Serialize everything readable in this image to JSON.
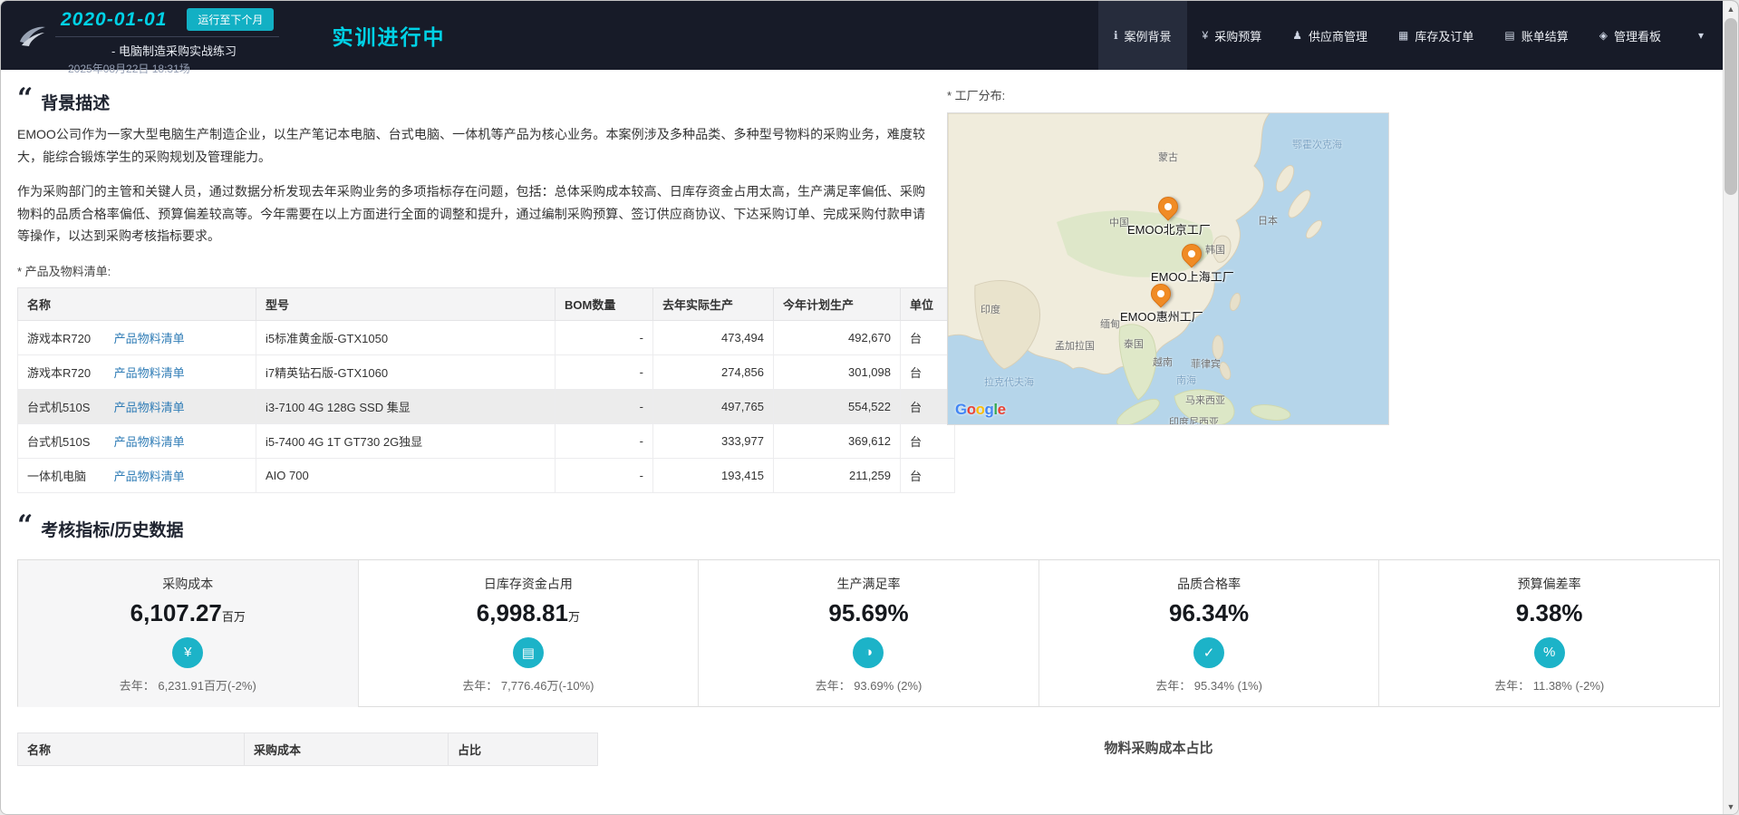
{
  "ui": {
    "quote_glyph": "“",
    "caret_glyph": "▾",
    "scroll_up_glyph": "▲",
    "scroll_down_glyph": "▼"
  },
  "navbar": {
    "date": "2020-01-01",
    "run_button": "运行至下个月",
    "subtitle": "- 电脑制造采购实战练习",
    "session": "2025年08月22日 18:31场",
    "status": "实训进行中",
    "items": [
      {
        "label": "案例背景",
        "icon": "info-icon",
        "glyph": "ℹ",
        "active": true
      },
      {
        "label": "采购预算",
        "icon": "budget-icon",
        "glyph": "¥",
        "active": false
      },
      {
        "label": "供应商管理",
        "icon": "supplier-icon",
        "glyph": "♟",
        "active": false
      },
      {
        "label": "库存及订单",
        "icon": "inventory-icon",
        "glyph": "▦",
        "active": false
      },
      {
        "label": "账单结算",
        "icon": "billing-icon",
        "glyph": "▤",
        "active": false
      },
      {
        "label": "管理看板",
        "icon": "dashboard-icon",
        "glyph": "◈",
        "active": false
      }
    ]
  },
  "background": {
    "title": "背景描述",
    "paragraphs": [
      "EMOO公司作为一家大型电脑生产制造企业，以生产笔记本电脑、台式电脑、一体机等产品为核心业务。本案例涉及多种品类、多种型号物料的采购业务，难度较大，能综合锻炼学生的采购规划及管理能力。",
      "作为采购部门的主管和关键人员，通过数据分析发现去年采购业务的多项指标存在问题，包括：总体采购成本较高、日库存资金占用太高，生产满足率偏低、采购物料的品质合格率偏低、预算偏差较高等。今年需要在以上方面进行全面的调整和提升，通过编制采购预算、签订供应商协议、下达采购订单、完成采购付款申请等操作，以达到采购考核指标要求。"
    ],
    "product_list_label": "* 产品及物料清单:",
    "table": {
      "headers": [
        "名称",
        "型号",
        "BOM数量",
        "去年实际生产",
        "今年计划生产",
        "单位"
      ],
      "link_label": "产品物料清单",
      "rows": [
        {
          "name": "游戏本R720",
          "model": "i5标准黄金版-GTX1050",
          "bom": "-",
          "last": "473,494",
          "plan": "492,670",
          "unit": "台"
        },
        {
          "name": "游戏本R720",
          "model": "i7精英钻石版-GTX1060",
          "bom": "-",
          "last": "274,856",
          "plan": "301,098",
          "unit": "台"
        },
        {
          "name": "台式机510S",
          "model": "i3-7100 4G 128G SSD 集显",
          "bom": "-",
          "last": "497,765",
          "plan": "554,522",
          "unit": "台"
        },
        {
          "name": "台式机510S",
          "model": "i5-7400 4G 1T GT730 2G独显",
          "bom": "-",
          "last": "333,977",
          "plan": "369,612",
          "unit": "台"
        },
        {
          "name": "一体机电脑",
          "model": "AIO 700",
          "bom": "-",
          "last": "193,415",
          "plan": "211,259",
          "unit": "台"
        }
      ]
    }
  },
  "map": {
    "label": "* 工厂分布:",
    "pins": [
      {
        "label": "EMOO北京工厂"
      },
      {
        "label": "EMOO上海工厂"
      },
      {
        "label": "EMOO惠州工厂"
      }
    ],
    "labels": [
      {
        "text": "蒙古"
      },
      {
        "text": "中国"
      },
      {
        "text": "日本"
      },
      {
        "text": "韩国"
      },
      {
        "text": "印度"
      },
      {
        "text": "缅甸"
      },
      {
        "text": "泰国"
      },
      {
        "text": "越南"
      },
      {
        "text": "菲律宾"
      },
      {
        "text": "马来西亚"
      },
      {
        "text": "印度尼西亚"
      },
      {
        "text": "孟加拉国"
      },
      {
        "text": "鄂霍次克海"
      },
      {
        "text": "拉克代夫海"
      },
      {
        "text": "南海"
      }
    ],
    "google_letters": [
      "G",
      "o",
      "o",
      "g",
      "l",
      "e"
    ],
    "google_colors": [
      "#4285F4",
      "#EA4335",
      "#FBBC05",
      "#4285F4",
      "#34A853",
      "#EA4335"
    ]
  },
  "kpi": {
    "title": "考核指标/历史数据",
    "cards": [
      {
        "label": "采购成本",
        "value": "6,107.27",
        "unit": "百万",
        "icon": "money-icon",
        "glyph": "¥",
        "last": "去年： 6,231.91百万(-2%)"
      },
      {
        "label": "日库存资金占用",
        "value": "6,998.81",
        "unit": "万",
        "icon": "bank-icon",
        "glyph": "▤",
        "last": "去年： 7,776.46万(-10%)"
      },
      {
        "label": "生产满足率",
        "value": "95.69%",
        "unit": "",
        "icon": "production-icon",
        "glyph": "◑",
        "last": "去年： 93.69% (2%)"
      },
      {
        "label": "品质合格率",
        "value": "96.34%",
        "unit": "",
        "icon": "quality-icon",
        "glyph": "✓",
        "last": "去年： 95.34% (1%)"
      },
      {
        "label": "预算偏差率",
        "value": "9.38%",
        "unit": "",
        "icon": "deviation-icon",
        "glyph": "%",
        "last": "去年： 11.38% (-2%)"
      }
    ]
  },
  "bottom": {
    "table_headers": [
      "名称",
      "采购成本",
      "占比"
    ],
    "chart_title": "物料采购成本占比"
  }
}
